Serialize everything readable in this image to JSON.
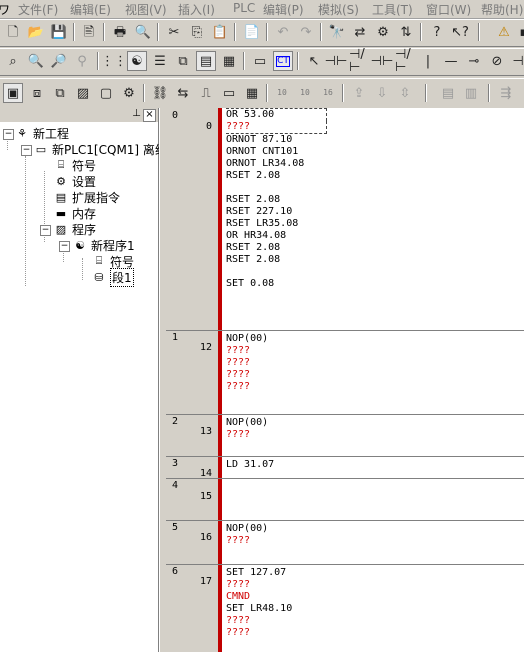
{
  "menu": [
    "文件(F)",
    "编辑(E)",
    "视图(V)",
    "插入(I)",
    "PLC",
    "编辑(P)",
    "模拟(S)",
    "工具(T)",
    "窗口(W)",
    "帮助(H)"
  ],
  "toolbar3": {
    "tiny1": "10",
    "tiny2": "10",
    "tiny3": "16"
  },
  "tree": {
    "root": "新工程",
    "plc": "新PLC1[CQM1] 离线",
    "symbols": "符号",
    "settings": "设置",
    "ext_instr": "扩展指令",
    "memory": "内存",
    "programs": "程序",
    "new_program": "新程序1",
    "prog_symbols": "符号",
    "section": "段1"
  },
  "rungs": [
    {
      "index": "0",
      "step": "0",
      "lines": [
        {
          "t": "OR 53.00",
          "c": "k"
        },
        {
          "t": "????",
          "c": "r"
        },
        {
          "t": "ORNOT 87.10",
          "c": "k"
        },
        {
          "t": "ORNOT CNT101",
          "c": "k"
        },
        {
          "t": "ORNOT LR34.08",
          "c": "k"
        },
        {
          "t": "RSET 2.08",
          "c": "k"
        },
        {
          "t": "",
          "c": "k"
        },
        {
          "t": "RSET 2.08",
          "c": "k"
        },
        {
          "t": "RSET 227.10",
          "c": "k"
        },
        {
          "t": "RSET LR35.08",
          "c": "k"
        },
        {
          "t": "OR HR34.08",
          "c": "k"
        },
        {
          "t": "RSET 2.08",
          "c": "k"
        },
        {
          "t": "RSET 2.08",
          "c": "k"
        },
        {
          "t": "",
          "c": "k"
        },
        {
          "t": "SET 0.08",
          "c": "k"
        }
      ]
    },
    {
      "index": "1",
      "step": "12",
      "lines": [
        {
          "t": "NOP(00)",
          "c": "k"
        },
        {
          "t": "????",
          "c": "r"
        },
        {
          "t": "????",
          "c": "r"
        },
        {
          "t": "????",
          "c": "r"
        },
        {
          "t": "????",
          "c": "r"
        }
      ]
    },
    {
      "index": "2",
      "step": "13",
      "lines": [
        {
          "t": "NOP(00)",
          "c": "k"
        },
        {
          "t": "????",
          "c": "r"
        }
      ]
    },
    {
      "index": "3",
      "step": "14",
      "lines": [
        {
          "t": "LD 31.07",
          "c": "k"
        }
      ]
    },
    {
      "index": "4",
      "step": "15",
      "lines": []
    },
    {
      "index": "5",
      "step": "16",
      "lines": [
        {
          "t": "NOP(00)",
          "c": "k"
        },
        {
          "t": "????",
          "c": "r"
        }
      ]
    },
    {
      "index": "6",
      "step": "17",
      "lines": [
        {
          "t": "SET 127.07",
          "c": "k"
        },
        {
          "t": "????",
          "c": "r"
        },
        {
          "t": "CMND",
          "c": "r"
        },
        {
          "t": "SET LR48.10",
          "c": "k"
        },
        {
          "t": "????",
          "c": "r"
        },
        {
          "t": "????",
          "c": "r"
        }
      ]
    }
  ],
  "colors": {
    "red": "#c00000",
    "error_text": "#d00000",
    "panel": "#d4d0c8"
  }
}
